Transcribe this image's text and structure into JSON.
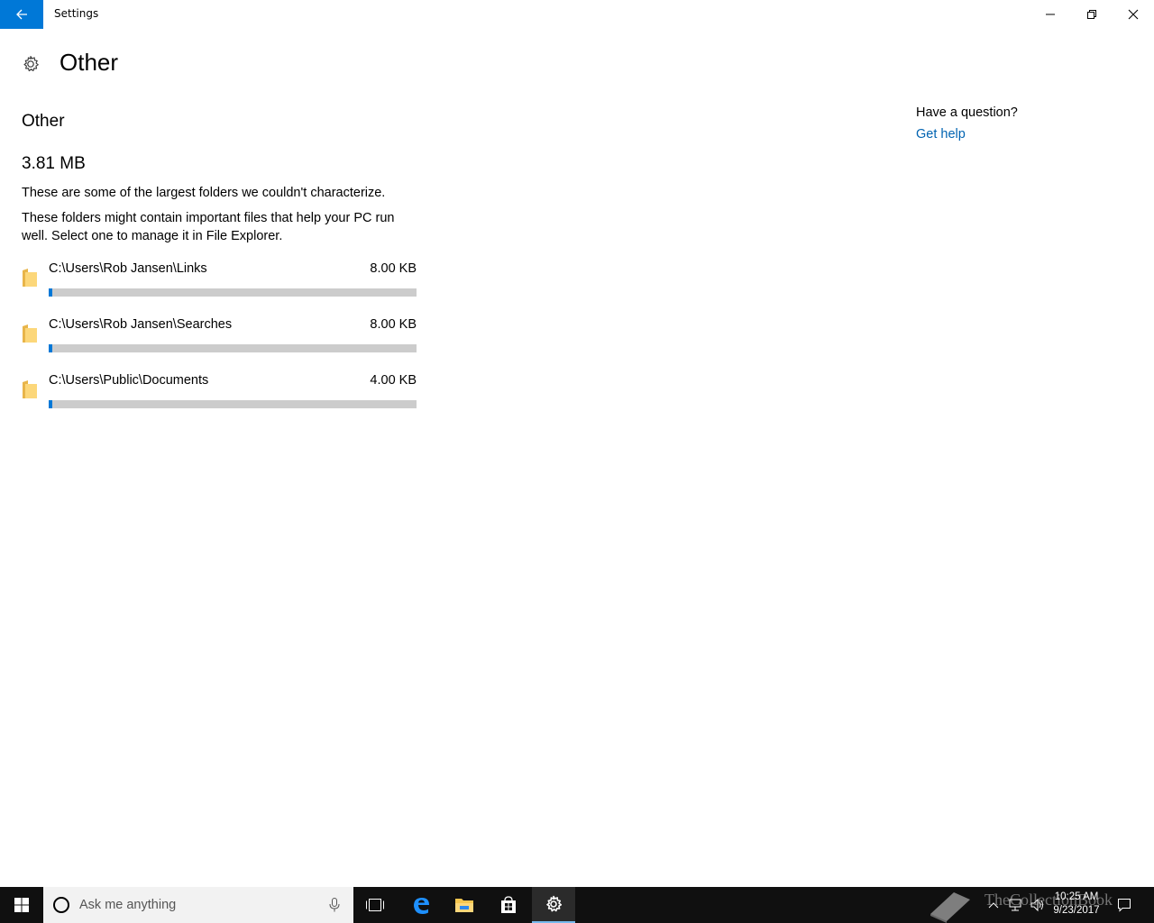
{
  "window": {
    "title": "Settings"
  },
  "header": {
    "title": "Other"
  },
  "section": {
    "title": "Other",
    "total_size": "3.81 MB"
  },
  "description": {
    "line1": "These are some of the largest folders we couldn't characterize.",
    "line2": "These folders might contain important files that help your PC run well. Select one to manage it in File Explorer."
  },
  "folders": [
    {
      "path": "C:\\Users\\Rob Jansen\\Links",
      "size": "8.00 KB",
      "fill_percent": 1
    },
    {
      "path": "C:\\Users\\Rob Jansen\\Searches",
      "size": "8.00 KB",
      "fill_percent": 1
    },
    {
      "path": "C:\\Users\\Public\\Documents",
      "size": "4.00 KB",
      "fill_percent": 1
    }
  ],
  "help": {
    "question": "Have a question?",
    "link": "Get help"
  },
  "taskbar": {
    "search_placeholder": "Ask me anything",
    "time": "10:25 AM",
    "date": "9/23/2017",
    "watermark": "TheCollectionBook"
  },
  "colors": {
    "accent": "#0078d7",
    "link": "#0063b1",
    "taskbar": "#101010"
  }
}
